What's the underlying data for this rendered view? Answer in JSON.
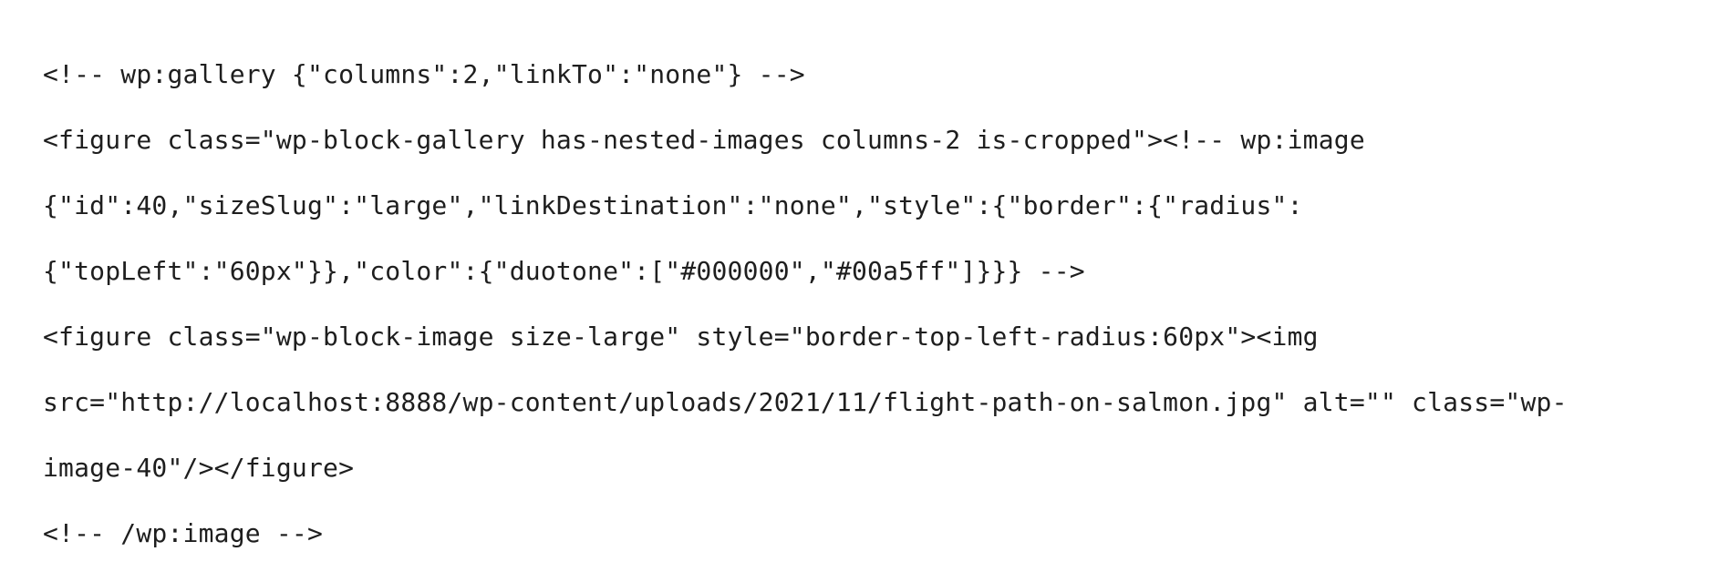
{
  "code_view": {
    "lines": [
      "<!-- wp:gallery {\"columns\":2,\"linkTo\":\"none\"} -->",
      "<figure class=\"wp-block-gallery has-nested-images columns-2 is-cropped\"><!-- wp:image",
      "{\"id\":40,\"sizeSlug\":\"large\",\"linkDestination\":\"none\",\"style\":{\"border\":{\"radius\":",
      "{\"topLeft\":\"60px\"}},\"color\":{\"duotone\":[\"#000000\",\"#00a5ff\"]}}} -->",
      "<figure class=\"wp-block-image size-large\" style=\"border-top-left-radius:60px\"><img",
      "src=\"http://localhost:8888/wp-content/uploads/2021/11/flight-path-on-salmon.jpg\" alt=\"\" class=\"wp-",
      "image-40\"/></figure>",
      "<!-- /wp:image -->"
    ]
  }
}
